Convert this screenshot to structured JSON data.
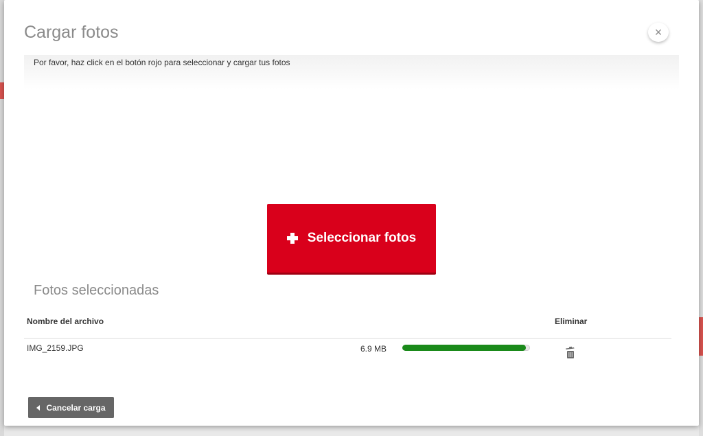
{
  "modal": {
    "title": "Cargar fotos",
    "close_glyph": "×",
    "instructions": "Por favor, haz click en el botón rojo para seleccionar y cargar tus fotos"
  },
  "select_button": {
    "label": "Seleccionar fotos",
    "icon": "plus-icon",
    "color": "#d9001b"
  },
  "files": {
    "section_title": "Fotos seleccionadas",
    "headers": {
      "name": "Nombre del archivo",
      "delete": "Eliminar"
    },
    "rows": [
      {
        "name": "IMG_2159.JPG",
        "size": "6.9 MB",
        "progress_percent": 97,
        "progress_color": "#1a8a1a",
        "delete_icon": "trash-icon"
      }
    ]
  },
  "cancel_button": {
    "label": "Cancelar carga",
    "icon": "caret-left-icon"
  }
}
